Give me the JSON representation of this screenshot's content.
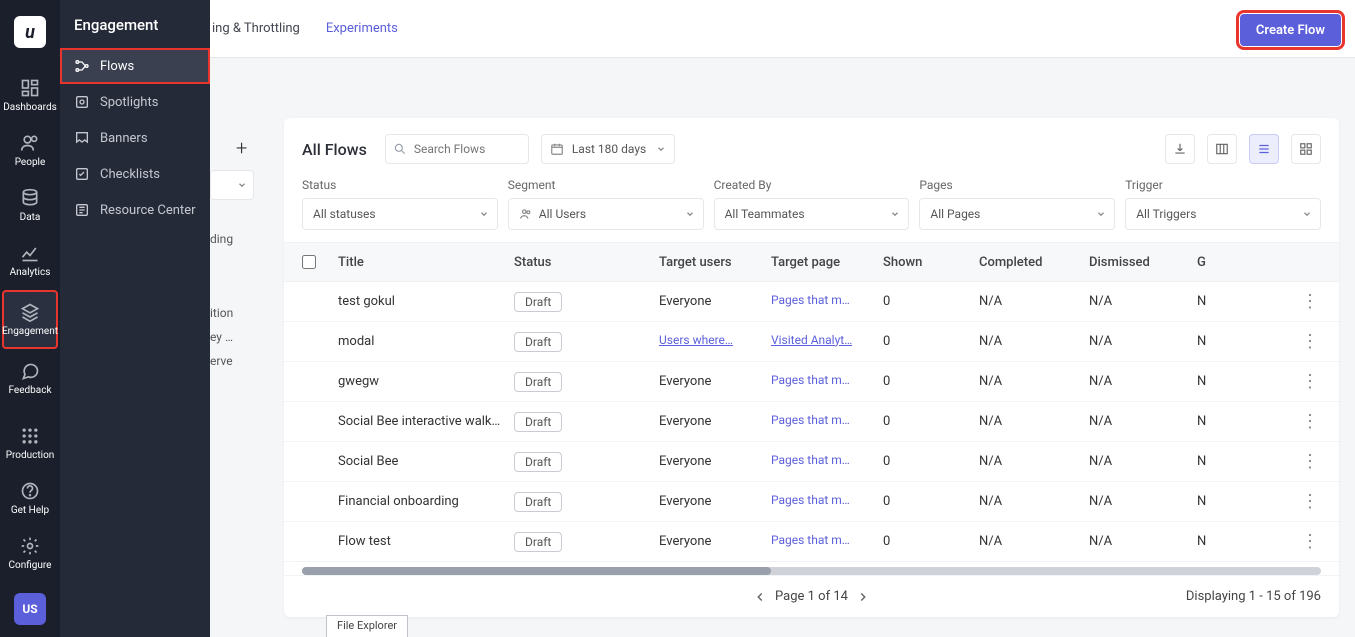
{
  "rail": {
    "logo": "u",
    "items": [
      {
        "id": "dashboards",
        "label": "Dashboards"
      },
      {
        "id": "people",
        "label": "People"
      },
      {
        "id": "data",
        "label": "Data"
      },
      {
        "id": "analytics",
        "label": "Analytics"
      },
      {
        "id": "engagement",
        "label": "Engagement"
      },
      {
        "id": "feedback",
        "label": "Feedback"
      }
    ],
    "bottom": [
      {
        "id": "production",
        "label": "Production"
      },
      {
        "id": "gethelp",
        "label": "Get Help"
      },
      {
        "id": "configure",
        "label": "Configure"
      }
    ],
    "avatar": "US"
  },
  "sub": {
    "title": "Engagement",
    "items": [
      {
        "id": "flows",
        "label": "Flows"
      },
      {
        "id": "spotlights",
        "label": "Spotlights"
      },
      {
        "id": "banners",
        "label": "Banners"
      },
      {
        "id": "checklists",
        "label": "Checklists"
      },
      {
        "id": "resource",
        "label": "Resource Center"
      }
    ]
  },
  "top": {
    "tabs": [
      {
        "id": "throttle",
        "label": "ing & Throttling"
      },
      {
        "id": "experiments",
        "label": "Experiments"
      }
    ],
    "create": "Create Flow"
  },
  "stub": {
    "texts": [
      "ding",
      "ition",
      "ey …",
      "erve"
    ]
  },
  "panel": {
    "title": "All Flows",
    "search_placeholder": "Search Flows",
    "date": "Last 180 days",
    "filters": {
      "status": {
        "label": "Status",
        "value": "All statuses"
      },
      "segment": {
        "label": "Segment",
        "value": "All Users"
      },
      "created": {
        "label": "Created By",
        "value": "All Teammates"
      },
      "pages": {
        "label": "Pages",
        "value": "All Pages"
      },
      "trigger": {
        "label": "Trigger",
        "value": "All Triggers"
      }
    },
    "columns": [
      "Title",
      "Status",
      "Target users",
      "Target page",
      "Shown",
      "Completed",
      "Dismissed",
      "G"
    ],
    "rows": [
      {
        "title": "test gokul",
        "status": "Draft",
        "target": "Everyone",
        "page": "Pages that m…",
        "page_ul": false,
        "target_ul": false,
        "shown": "0",
        "completed": "N/A",
        "dismissed": "N/A",
        "g": "N"
      },
      {
        "title": "modal",
        "status": "Draft",
        "target": "Users where…",
        "page": "Visited Analyt…",
        "page_ul": true,
        "target_ul": true,
        "shown": "0",
        "completed": "N/A",
        "dismissed": "N/A",
        "g": "N"
      },
      {
        "title": "gwegw",
        "status": "Draft",
        "target": "Everyone",
        "page": "Pages that m…",
        "page_ul": false,
        "target_ul": false,
        "shown": "0",
        "completed": "N/A",
        "dismissed": "N/A",
        "g": "N"
      },
      {
        "title": "Social Bee interactive walkt…",
        "status": "Draft",
        "target": "Everyone",
        "page": "Pages that m…",
        "page_ul": false,
        "target_ul": false,
        "shown": "0",
        "completed": "N/A",
        "dismissed": "N/A",
        "g": "N"
      },
      {
        "title": "Social Bee",
        "status": "Draft",
        "target": "Everyone",
        "page": "Pages that m…",
        "page_ul": false,
        "target_ul": false,
        "shown": "0",
        "completed": "N/A",
        "dismissed": "N/A",
        "g": "N"
      },
      {
        "title": "Financial onboarding",
        "status": "Draft",
        "target": "Everyone",
        "page": "Pages that m…",
        "page_ul": false,
        "target_ul": false,
        "shown": "0",
        "completed": "N/A",
        "dismissed": "N/A",
        "g": "N"
      },
      {
        "title": "Flow test",
        "status": "Draft",
        "target": "Everyone",
        "page": "Pages that m…",
        "page_ul": false,
        "target_ul": false,
        "shown": "0",
        "completed": "N/A",
        "dismissed": "N/A",
        "g": "N"
      }
    ],
    "pager": {
      "text": "Page 1 of 14",
      "count": "Displaying 1 - 15 of 196"
    }
  },
  "file_explorer": "File Explorer"
}
